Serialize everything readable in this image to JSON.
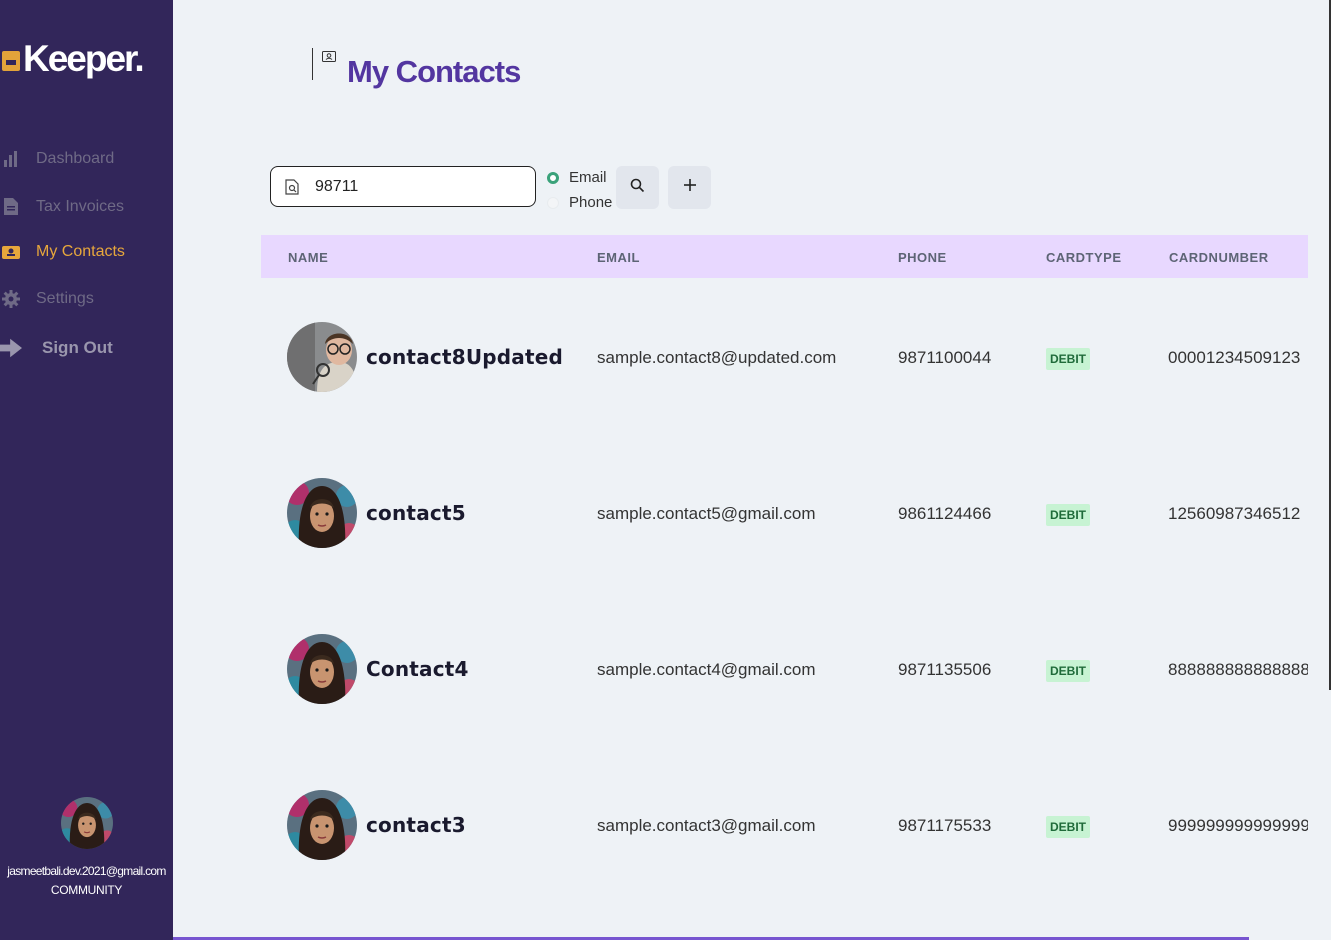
{
  "brand": {
    "name": "Keeper."
  },
  "sidebar": {
    "items": [
      {
        "label": "Dashboard",
        "icon": "bar-chart-icon"
      },
      {
        "label": "Tax Invoices",
        "icon": "document-icon"
      },
      {
        "label": "My Contacts",
        "icon": "contact-card-icon",
        "active": true
      },
      {
        "label": "Settings",
        "icon": "gear-icon"
      },
      {
        "label": "Sign Out",
        "icon": "arrow-right-icon"
      }
    ],
    "profile": {
      "email": "jasmeetbali.dev.2021@gmail.com",
      "role": "COMMUNITY"
    }
  },
  "page": {
    "title": "My Contacts"
  },
  "search": {
    "value": "98711",
    "options": [
      "Email",
      "Phone"
    ],
    "selected": "Email"
  },
  "table": {
    "headers": [
      "NAME",
      "EMAIL",
      "PHONE",
      "CARDTYPE",
      "CARDNUMBER"
    ],
    "rows": [
      {
        "name": "contact8Updated",
        "email": "sample.contact8@updated.com",
        "phone": "9871100044",
        "cardtype": "DEBIT",
        "cardnumber": "00001234509123"
      },
      {
        "name": "contact5",
        "email": "sample.contact5@gmail.com",
        "phone": "9861124466",
        "cardtype": "DEBIT",
        "cardnumber": "12560987346512"
      },
      {
        "name": "Contact4",
        "email": "sample.contact4@gmail.com",
        "phone": "9871135506",
        "cardtype": "DEBIT",
        "cardnumber": "888888888888888"
      },
      {
        "name": "contact3",
        "email": "sample.contact3@gmail.com",
        "phone": "9871175533",
        "cardtype": "DEBIT",
        "cardnumber": "999999999999999"
      }
    ]
  },
  "colors": {
    "sidebar": "#32265a",
    "accent": "#5336a0",
    "active": "#e7a73c",
    "header": "#e8d8ff",
    "badge": "#c7f3d3"
  }
}
